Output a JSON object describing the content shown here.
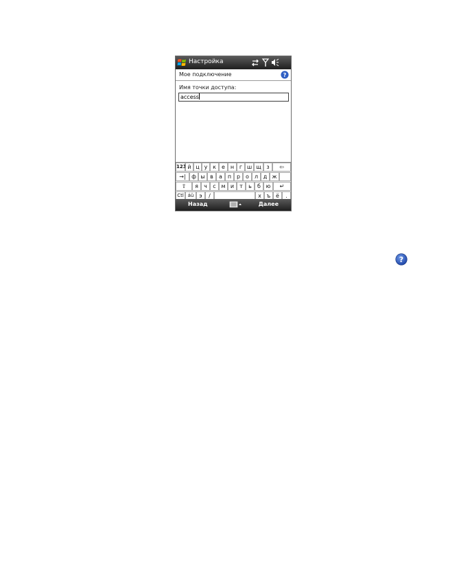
{
  "window": {
    "title": "Настройка"
  },
  "header": {
    "subtitle": "Мое подключение"
  },
  "form": {
    "label": "Имя точки доступа:",
    "value": "access"
  },
  "keyboard": {
    "row1": [
      "123",
      "й",
      "ц",
      "у",
      "к",
      "е",
      "н",
      "г",
      "ш",
      "щ",
      "з",
      "⇦"
    ],
    "row2": [
      "→|",
      "ф",
      "ы",
      "в",
      "а",
      "п",
      "р",
      "о",
      "л",
      "д",
      "ж"
    ],
    "row3": [
      "⇧",
      "я",
      "ч",
      "с",
      "м",
      "и",
      "т",
      "ь",
      "б",
      "ю",
      "↵"
    ],
    "row4": [
      "Ctl",
      "áü",
      "э",
      "/",
      " ",
      "х",
      "ъ",
      "ё",
      "."
    ]
  },
  "softkeys": {
    "left": "Назад",
    "right": "Далее"
  },
  "icons": [
    "windows-logo-icon",
    "connectivity-icon",
    "signal-icon",
    "speaker-icon",
    "help-icon",
    "keyboard-icon"
  ],
  "colors": {
    "titlebar": "#2e2e2e",
    "help": "#2f5fc4"
  }
}
